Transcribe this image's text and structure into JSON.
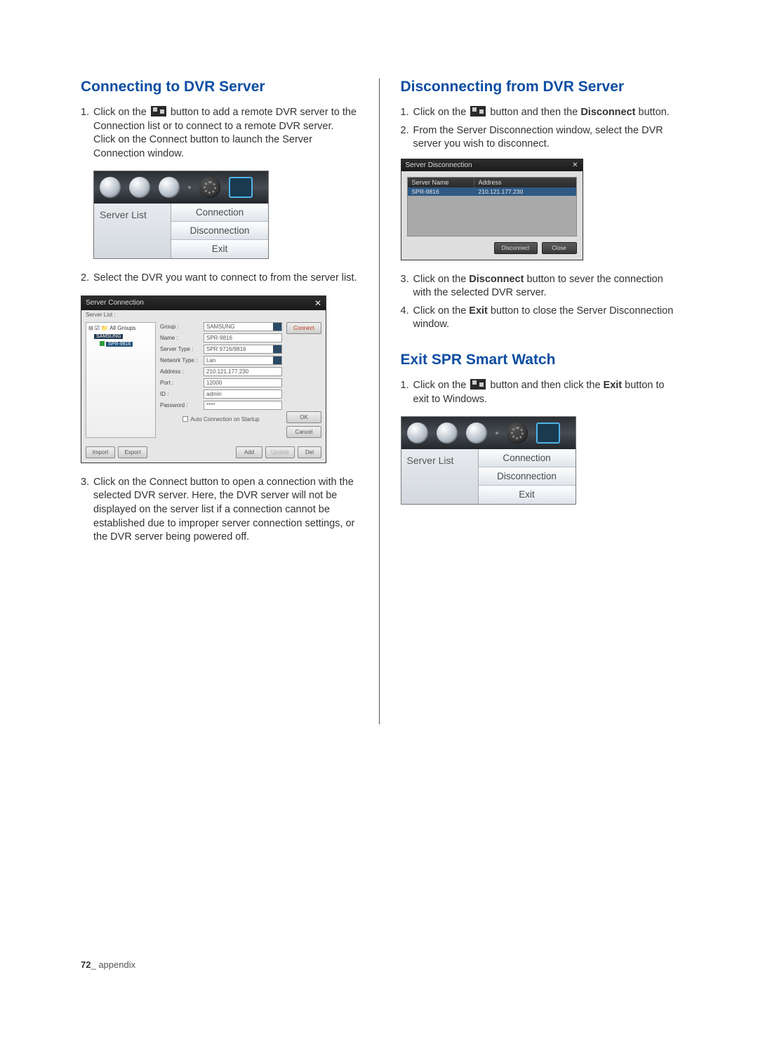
{
  "page": {
    "number": "72",
    "section_label": "appendix"
  },
  "left": {
    "heading": "Connecting to DVR Server",
    "steps": {
      "s1_pre": "Click on the ",
      "s1_post": " button to add a remote DVR server to the Connection list or to connect to a remote DVR server. Click on the Connect button to launch the Server Connection window.",
      "s2": "Select the DVR you want to connect to from the server list.",
      "s3": "Click on the Connect button to open a connection with the selected DVR server. Here, the DVR server will not be displayed on the server list if a connection cannot be established due to improper server connection settings, or the DVR server being powered off."
    },
    "fig1": {
      "server_list": "Server List",
      "menu": {
        "connection": "Connection",
        "disconnection": "Disconnection",
        "exit": "Exit"
      }
    },
    "fig2": {
      "title": "Server Connection",
      "server_list_label": "Server List :",
      "tree": {
        "root": "⊟ ☑ 📁 All Groups",
        "group": "SAMSUNG",
        "server": "SPR-9816"
      },
      "labels": {
        "group": "Group :",
        "name": "Name :",
        "server_type": "Server Type :",
        "network_type": "Network Type :",
        "address": "Address :",
        "port": "Port :",
        "id": "ID :",
        "password": "Password :"
      },
      "values": {
        "group": "SAMSUNG",
        "name": "SPR-9816",
        "server_type": "SPR 9716/9816",
        "network_type": "Lan",
        "address": "210.121.177.230",
        "port": "12000",
        "id": "admin",
        "password": "****"
      },
      "auto": "Auto Connection on Startup",
      "buttons": {
        "connect": "Connect",
        "ok": "OK",
        "cancel": "Cancel",
        "import": "Import",
        "export": "Export",
        "add": "Add",
        "update": "Update",
        "del": "Del"
      }
    }
  },
  "right": {
    "heading1": "Disconnecting from DVR Server",
    "steps1": {
      "s1_pre": "Click on the ",
      "s1_mid": " button and then the ",
      "s1_bold": "Disconnect",
      "s1_post": " button.",
      "s2": "From the Server Disconnection window, select the DVR server you wish to disconnect.",
      "s3_pre": "Click on the ",
      "s3_bold": "Disconnect",
      "s3_post": " button to sever the connection with the selected DVR server.",
      "s4_pre": "Click on the ",
      "s4_bold": "Exit",
      "s4_post": " button to close the Server Disconnection window."
    },
    "fig3": {
      "title": "Server Disconnection",
      "headers": {
        "name": "Server Name",
        "address": "Address"
      },
      "row": {
        "name": "SPR-9816",
        "address": "210.121.177.230"
      },
      "buttons": {
        "disconnect": "Disconnect",
        "close": "Close"
      }
    },
    "heading2": "Exit SPR Smart Watch",
    "steps2": {
      "s1_pre": "Click on the ",
      "s1_mid": " button and then click the ",
      "s1_bold": "Exit",
      "s1_post": " button to exit to Windows."
    },
    "fig4": {
      "server_list": "Server List",
      "menu": {
        "connection": "Connection",
        "disconnection": "Disconnection",
        "exit": "Exit"
      }
    }
  }
}
